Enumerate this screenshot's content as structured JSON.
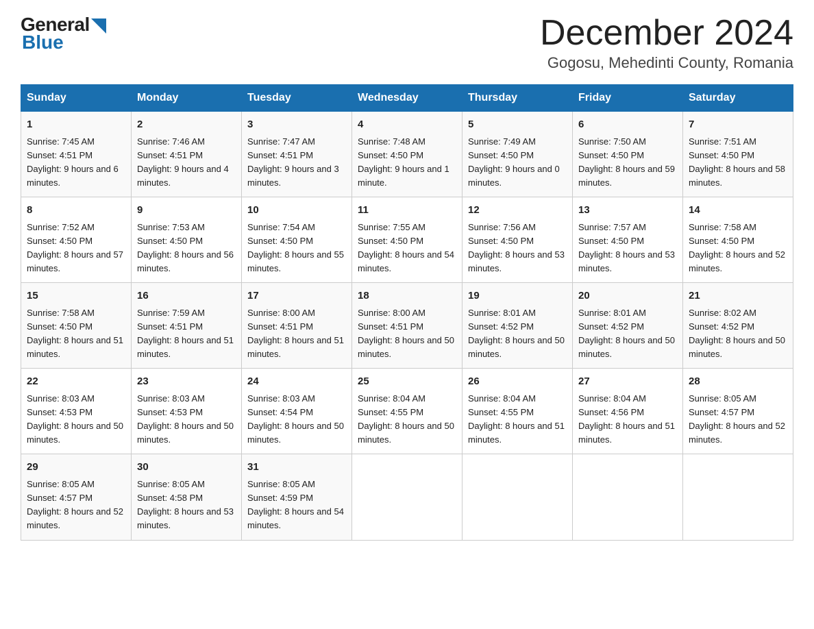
{
  "logo": {
    "general": "General",
    "blue": "Blue"
  },
  "header": {
    "month": "December 2024",
    "location": "Gogosu, Mehedinti County, Romania"
  },
  "weekdays": [
    "Sunday",
    "Monday",
    "Tuesday",
    "Wednesday",
    "Thursday",
    "Friday",
    "Saturday"
  ],
  "weeks": [
    [
      {
        "day": "1",
        "sunrise": "7:45 AM",
        "sunset": "4:51 PM",
        "daylight": "9 hours and 6 minutes."
      },
      {
        "day": "2",
        "sunrise": "7:46 AM",
        "sunset": "4:51 PM",
        "daylight": "9 hours and 4 minutes."
      },
      {
        "day": "3",
        "sunrise": "7:47 AM",
        "sunset": "4:51 PM",
        "daylight": "9 hours and 3 minutes."
      },
      {
        "day": "4",
        "sunrise": "7:48 AM",
        "sunset": "4:50 PM",
        "daylight": "9 hours and 1 minute."
      },
      {
        "day": "5",
        "sunrise": "7:49 AM",
        "sunset": "4:50 PM",
        "daylight": "9 hours and 0 minutes."
      },
      {
        "day": "6",
        "sunrise": "7:50 AM",
        "sunset": "4:50 PM",
        "daylight": "8 hours and 59 minutes."
      },
      {
        "day": "7",
        "sunrise": "7:51 AM",
        "sunset": "4:50 PM",
        "daylight": "8 hours and 58 minutes."
      }
    ],
    [
      {
        "day": "8",
        "sunrise": "7:52 AM",
        "sunset": "4:50 PM",
        "daylight": "8 hours and 57 minutes."
      },
      {
        "day": "9",
        "sunrise": "7:53 AM",
        "sunset": "4:50 PM",
        "daylight": "8 hours and 56 minutes."
      },
      {
        "day": "10",
        "sunrise": "7:54 AM",
        "sunset": "4:50 PM",
        "daylight": "8 hours and 55 minutes."
      },
      {
        "day": "11",
        "sunrise": "7:55 AM",
        "sunset": "4:50 PM",
        "daylight": "8 hours and 54 minutes."
      },
      {
        "day": "12",
        "sunrise": "7:56 AM",
        "sunset": "4:50 PM",
        "daylight": "8 hours and 53 minutes."
      },
      {
        "day": "13",
        "sunrise": "7:57 AM",
        "sunset": "4:50 PM",
        "daylight": "8 hours and 53 minutes."
      },
      {
        "day": "14",
        "sunrise": "7:58 AM",
        "sunset": "4:50 PM",
        "daylight": "8 hours and 52 minutes."
      }
    ],
    [
      {
        "day": "15",
        "sunrise": "7:58 AM",
        "sunset": "4:50 PM",
        "daylight": "8 hours and 51 minutes."
      },
      {
        "day": "16",
        "sunrise": "7:59 AM",
        "sunset": "4:51 PM",
        "daylight": "8 hours and 51 minutes."
      },
      {
        "day": "17",
        "sunrise": "8:00 AM",
        "sunset": "4:51 PM",
        "daylight": "8 hours and 51 minutes."
      },
      {
        "day": "18",
        "sunrise": "8:00 AM",
        "sunset": "4:51 PM",
        "daylight": "8 hours and 50 minutes."
      },
      {
        "day": "19",
        "sunrise": "8:01 AM",
        "sunset": "4:52 PM",
        "daylight": "8 hours and 50 minutes."
      },
      {
        "day": "20",
        "sunrise": "8:01 AM",
        "sunset": "4:52 PM",
        "daylight": "8 hours and 50 minutes."
      },
      {
        "day": "21",
        "sunrise": "8:02 AM",
        "sunset": "4:52 PM",
        "daylight": "8 hours and 50 minutes."
      }
    ],
    [
      {
        "day": "22",
        "sunrise": "8:03 AM",
        "sunset": "4:53 PM",
        "daylight": "8 hours and 50 minutes."
      },
      {
        "day": "23",
        "sunrise": "8:03 AM",
        "sunset": "4:53 PM",
        "daylight": "8 hours and 50 minutes."
      },
      {
        "day": "24",
        "sunrise": "8:03 AM",
        "sunset": "4:54 PM",
        "daylight": "8 hours and 50 minutes."
      },
      {
        "day": "25",
        "sunrise": "8:04 AM",
        "sunset": "4:55 PM",
        "daylight": "8 hours and 50 minutes."
      },
      {
        "day": "26",
        "sunrise": "8:04 AM",
        "sunset": "4:55 PM",
        "daylight": "8 hours and 51 minutes."
      },
      {
        "day": "27",
        "sunrise": "8:04 AM",
        "sunset": "4:56 PM",
        "daylight": "8 hours and 51 minutes."
      },
      {
        "day": "28",
        "sunrise": "8:05 AM",
        "sunset": "4:57 PM",
        "daylight": "8 hours and 52 minutes."
      }
    ],
    [
      {
        "day": "29",
        "sunrise": "8:05 AM",
        "sunset": "4:57 PM",
        "daylight": "8 hours and 52 minutes."
      },
      {
        "day": "30",
        "sunrise": "8:05 AM",
        "sunset": "4:58 PM",
        "daylight": "8 hours and 53 minutes."
      },
      {
        "day": "31",
        "sunrise": "8:05 AM",
        "sunset": "4:59 PM",
        "daylight": "8 hours and 54 minutes."
      },
      null,
      null,
      null,
      null
    ]
  ],
  "labels": {
    "sunrise": "Sunrise:",
    "sunset": "Sunset:",
    "daylight": "Daylight:"
  }
}
